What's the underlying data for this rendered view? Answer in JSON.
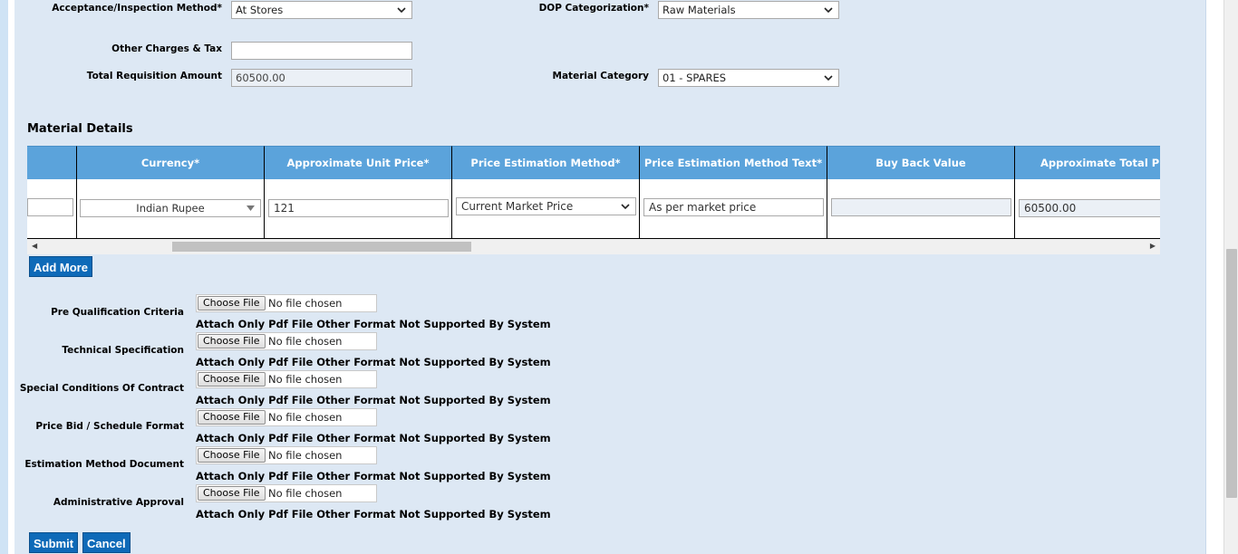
{
  "form": {
    "acceptance_label": "Acceptance/Inspection Method*",
    "acceptance_value": "At Stores",
    "dop_label": "DOP Categorization*",
    "dop_value": "Raw Materials",
    "other_charges_label": "Other Charges & Tax",
    "other_charges_value": "",
    "total_req_label": "Total Requisition Amount",
    "total_req_value": "60500.00",
    "material_category_label": "Material Category",
    "material_category_value": "01 - SPARES"
  },
  "material_details": {
    "title": "Material Details",
    "columns": [
      {
        "header": "",
        "value": ""
      },
      {
        "header": "Currency*",
        "value": "Indian Rupee"
      },
      {
        "header": "Approximate Unit Price*",
        "value": "121"
      },
      {
        "header": "Price Estimation Method*",
        "value": "Current Market Price"
      },
      {
        "header": "Price Estimation Method Text*",
        "value": "As per market price"
      },
      {
        "header": "Buy Back Value",
        "value": ""
      },
      {
        "header": "Approximate Total Price",
        "value": "60500.00"
      }
    ]
  },
  "buttons": {
    "add_more": "Add More",
    "submit": "Submit",
    "cancel": "Cancel"
  },
  "attachments": {
    "choose_file": "Choose File",
    "no_file": "No file chosen",
    "note": "Attach Only Pdf File Other Format Not Supported By System",
    "items": [
      {
        "label": "Pre Qualification Criteria"
      },
      {
        "label": "Technical Specification"
      },
      {
        "label": "Special Conditions Of Contract"
      },
      {
        "label": "Price Bid / Schedule Format"
      },
      {
        "label": "Estimation Method Document"
      },
      {
        "label": "Administrative Approval"
      }
    ]
  }
}
